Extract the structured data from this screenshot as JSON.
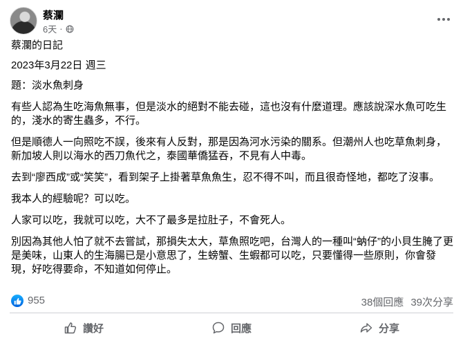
{
  "post": {
    "author": "蔡瀾",
    "time": "6天",
    "separator": "·",
    "privacy_icon": "globe-icon",
    "more_icon": "more-options-icon"
  },
  "content": {
    "title": "蔡瀾的日記",
    "date": "2023年3月22日  週三",
    "topic": "題：淡水魚刺身",
    "paragraphs": [
      "有些人認為生吃海魚無事，但是淡水的絕對不能去碰，這也沒有什麼道理。應該說深水魚可吃生的，淺水的寄生蟲多，不行。",
      "但是順德人一向照吃不誤，後來有人反對，那是因為河水污染的關系。但潮州人也吃草魚刺身，新加坡人則以海水的西刀魚代之，泰國華僑猛吞，不見有人中毒。",
      "去到“廖西成”或“笑笑”，看到架子上掛著草魚魚生，忍不得不叫，而且很奇怪地，都吃了沒事。",
      "我本人的經驗呢？可以吃。",
      "人家可以吃，我就可以吃，大不了最多是拉肚子，不會死人。",
      "別因為其他人怕了就不去嘗試，那損失太大，草魚照吃吧，台灣人的一種叫“蚋仔”的小貝生腌了更是美味，山東人的生海腸已是小意思了，生螃蟹、生蝦都可以吃，只要懂得一些原則，你會發現，好吃得要命，不知道如何停止。"
    ]
  },
  "stats": {
    "likes": "955",
    "comments": "38個回應",
    "shares": "39次分享"
  },
  "actions": {
    "like": "讚好",
    "comment": "回應",
    "share": "分享"
  },
  "colors": {
    "secondary_text": "#65676b",
    "like_blue": "#0866ff",
    "divider": "#ced0d4"
  }
}
